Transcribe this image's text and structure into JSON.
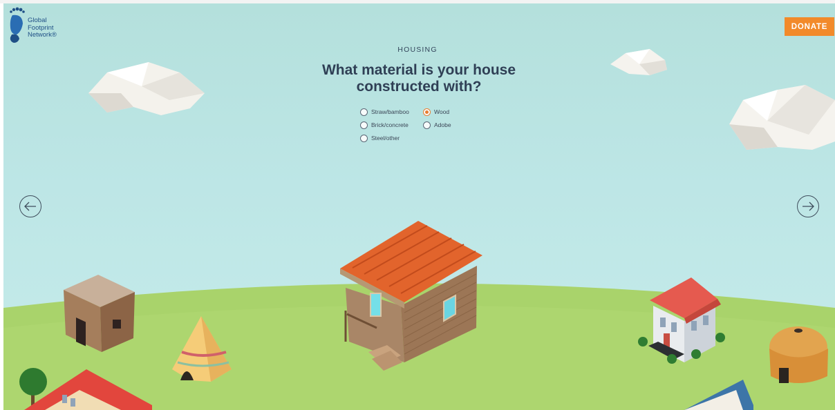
{
  "brand": {
    "logo_lines": [
      "Global",
      "Footprint",
      "Network®"
    ],
    "color": "#1f4f86"
  },
  "header": {
    "donate_label": "DONATE",
    "donate_color": "#f28a2a"
  },
  "quiz": {
    "category": "HOUSING",
    "question_line1": "What material is your house",
    "question_line2": "constructed with?",
    "options": [
      {
        "label": "Straw/bamboo",
        "selected": false
      },
      {
        "label": "Wood",
        "selected": true
      },
      {
        "label": "Brick/concrete",
        "selected": false
      },
      {
        "label": "Adobe",
        "selected": false
      },
      {
        "label": "Steel/other",
        "selected": false
      }
    ],
    "accent_color": "#e97d30"
  },
  "navigation": {
    "prev_icon": "arrow-left-icon",
    "next_icon": "arrow-right-icon"
  }
}
